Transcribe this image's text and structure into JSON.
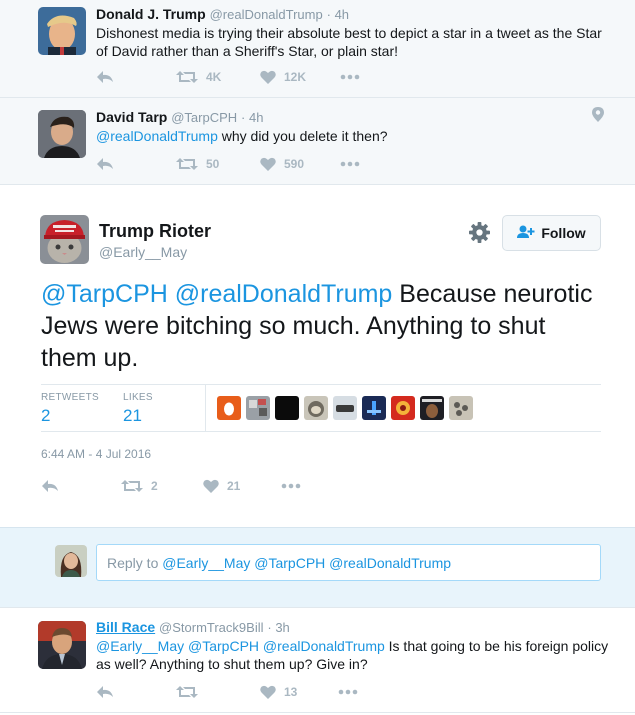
{
  "tweets": [
    {
      "name": "Donald J. Trump",
      "handle": "@realDonaldTrump",
      "time": "· 4h",
      "text": "Dishonest media is trying their absolute best to depict a star in a tweet as the Star of David rather than a Sheriff's Star, or plain star!",
      "retweets": "4K",
      "likes": "12K"
    },
    {
      "name": "David Tarp",
      "handle": "@TarpCPH",
      "time": "· 4h",
      "mention": "@realDonaldTrump",
      "text": " why did you delete it then?",
      "retweets": "50",
      "likes": "590"
    }
  ],
  "main": {
    "name": "Trump Rioter",
    "handle": "@Early__May",
    "follow_label": "Follow",
    "mentions": "@TarpCPH @realDonaldTrump",
    "text": " Because neurotic Jews were bitching so much. Anything to shut them up.",
    "retweets_label": "RETWEETS",
    "retweets": "2",
    "likes_label": "LIKES",
    "likes": "21",
    "timestamp": "6:44 AM - 4 Jul 2016",
    "action_retweets": "2",
    "action_likes": "21"
  },
  "reply": {
    "placeholder_prefix": "Reply to ",
    "placeholder_mentions": "@Early__May @TarpCPH @realDonaldTrump"
  },
  "bill": {
    "name": "Bill Race",
    "handle": "@StormTrack9Bill",
    "time": "· 3h",
    "mentions": "@Early__May @TarpCPH @realDonaldTrump",
    "text": " Is that going to be his foreign policy as well? Anything to shut them up? Give in?",
    "likes": "13"
  },
  "colors": {
    "link": "#1b95e0",
    "muted": "#8899a6",
    "icon": "#aab8c2",
    "thread_bg": "#f5f8fa",
    "reply_bg": "#e8f4fb"
  },
  "icons": [
    "reply-icon",
    "retweet-icon",
    "heart-icon",
    "more-icon",
    "location-icon",
    "gear-icon",
    "follow-person-icon"
  ]
}
